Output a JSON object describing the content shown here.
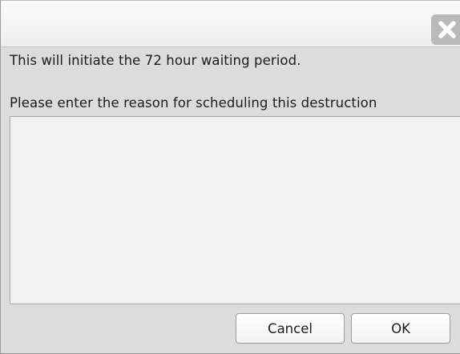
{
  "dialog": {
    "close_icon": "close-icon",
    "message_line": "This will initiate the 72 hour waiting period.",
    "prompt_line": "Please enter the reason for scheduling this destruction",
    "reason_value": "",
    "cancel_label": "Cancel",
    "ok_label": "OK"
  }
}
